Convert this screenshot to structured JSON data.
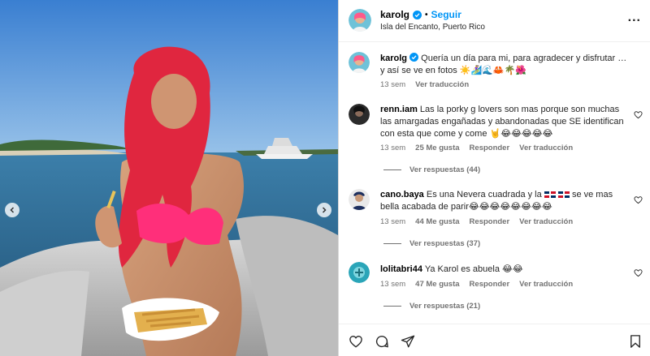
{
  "header": {
    "username": "karolg",
    "follow_label": "Seguir",
    "separator": "•",
    "location": "Isla del Encanto, Puerto Rico",
    "more_label": "..."
  },
  "caption": {
    "username": "karolg",
    "text": "Quería un día para mi, para agradecer y disfrutar … y así se ve en fotos ☀️🏄‍♀️🌊🦀🌴🌺",
    "time": "13 sem",
    "translate": "Ver traducción"
  },
  "comments": [
    {
      "username": "renn.iam",
      "text": "Las la porky g lovers son mas porque son muchas las amargadas engañadas y abandonadas que SE identifican con esta que come y come 🤘😂😂😂😂😂",
      "time": "13 sem",
      "likes": "25 Me gusta",
      "reply": "Responder",
      "translate": "Ver traducción",
      "view_replies": "Ver respuestas (44)"
    },
    {
      "username": "cano.baya",
      "text_before": "Es una Nevera cuadrada y la",
      "text_after": "se ve mas bella acabada de parir😂😂😂😂😂😂😂😂",
      "time": "13 sem",
      "likes": "44 Me gusta",
      "reply": "Responder",
      "translate": "Ver traducción",
      "view_replies": "Ver respuestas (37)"
    },
    {
      "username": "lolitabri44",
      "text": "Ya Karol es abuela 😂😂",
      "time": "13 sem",
      "likes": "47 Me gusta",
      "reply": "Responder",
      "translate": "Ver traducción",
      "view_replies": "Ver respuestas (21)"
    }
  ],
  "icons": {
    "like": "heart-icon",
    "comment": "comment-icon",
    "share": "share-icon",
    "save": "bookmark-icon"
  },
  "colors": {
    "follow": "#0095f6",
    "meta": "#737373",
    "verified": "#0095f6"
  }
}
